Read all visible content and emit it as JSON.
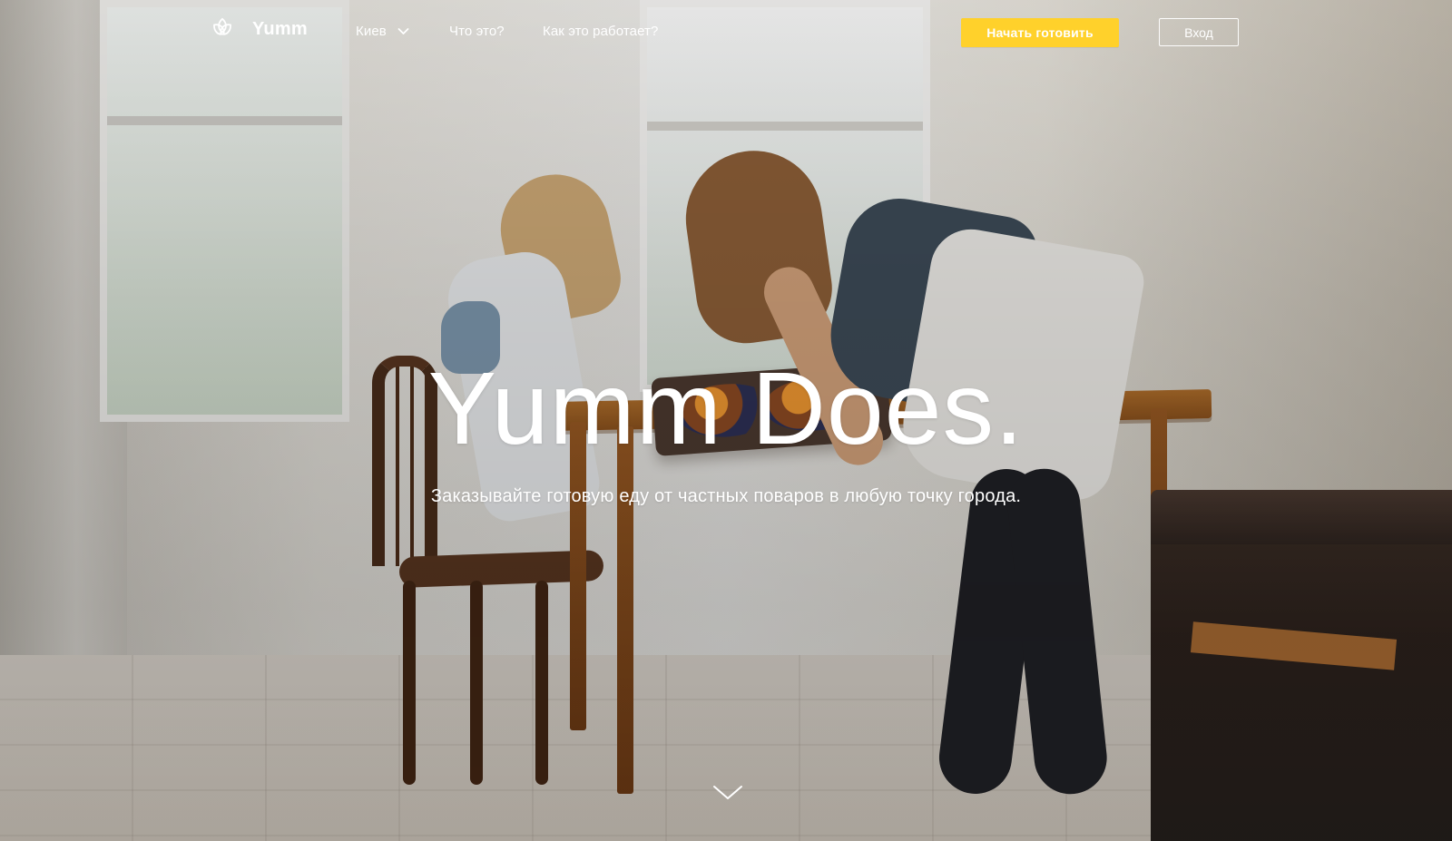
{
  "brand": {
    "logo_text": "Yumm",
    "accent_color": "#FFD12B"
  },
  "navigation": {
    "city": "Киев",
    "what_is_it": "Что это?",
    "how_it_works": "Как это работает?"
  },
  "actions": {
    "start_cooking": "Начать готовить",
    "login": "Вход"
  },
  "hero": {
    "title": "Yumm Does.",
    "subtitle": "Заказывайте готовую еду от частных поваров в любую точку города."
  },
  "icons": {
    "logo": "yumm-logo-icon",
    "city_dropdown": "chevron-down-icon",
    "scroll": "chevron-down-icon"
  }
}
